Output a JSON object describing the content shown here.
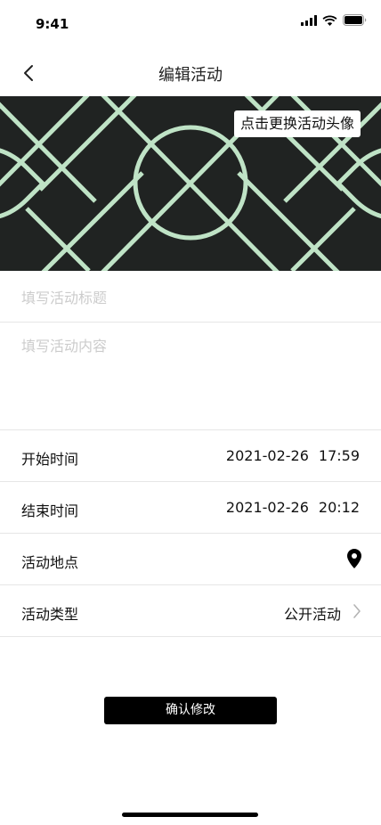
{
  "status_bar": {
    "time": "9:41"
  },
  "header": {
    "title": "编辑活动"
  },
  "cover": {
    "change_label": "点击更换活动头像",
    "pattern_color": "#bfe3c6",
    "background": "#202322"
  },
  "form": {
    "title_placeholder": "填写活动标题",
    "content_placeholder": "填写活动内容"
  },
  "rows": {
    "start": {
      "label": "开始时间",
      "date": "2021-02-26",
      "time": "17:59"
    },
    "end": {
      "label": "结束时间",
      "date": "2021-02-26",
      "time": "20:12"
    },
    "location": {
      "label": "活动地点",
      "icon": "location-pin-icon"
    },
    "type": {
      "label": "活动类型",
      "value": "公开活动",
      "icon": "chevron-right-icon"
    }
  },
  "actions": {
    "confirm_label": "确认修改"
  }
}
